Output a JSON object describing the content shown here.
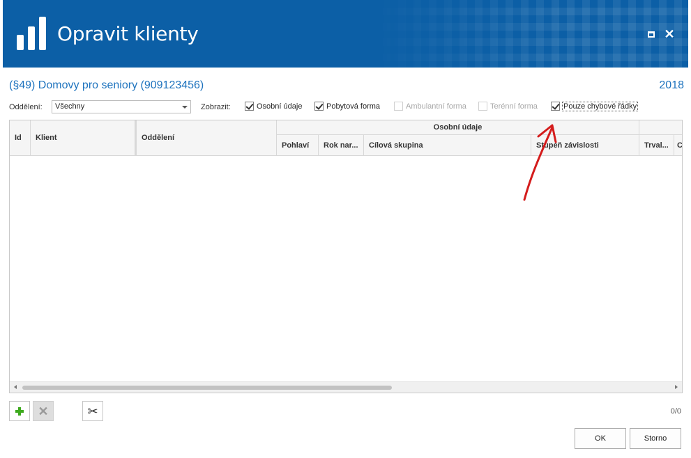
{
  "window": {
    "title": "Opravit klienty",
    "icon": "bar-chart-logo-icon",
    "controls": [
      "maximize-icon",
      "close-icon"
    ],
    "close_glyph": "✕"
  },
  "header": {
    "org_title": "(§49) Domovy pro seniory (909123456)",
    "year": "2018"
  },
  "filters": {
    "department_label": "Oddělení:",
    "department_value": "Všechny",
    "show_label": "Zobrazit:",
    "checkboxes": [
      {
        "label": "Osobní údaje",
        "checked": true,
        "enabled": true
      },
      {
        "label": "Pobytová forma",
        "checked": true,
        "enabled": true
      },
      {
        "label": "Ambulantní forma",
        "checked": false,
        "enabled": false
      },
      {
        "label": "Terénní forma",
        "checked": false,
        "enabled": false
      },
      {
        "label": "Pouze chybové řádky",
        "checked": true,
        "enabled": true
      }
    ]
  },
  "grid": {
    "group_header": "Osobní údaje",
    "columns": {
      "id": "Id",
      "client": "Klient",
      "department": "Oddělení",
      "gender": "Pohlaví",
      "birth_year": "Rok nar...",
      "target_group": "Cílová skupina",
      "dependency": "Stupeň závislosti",
      "permanent": "Trval...",
      "extra": "C"
    },
    "rows": []
  },
  "toolbar": {
    "add_icon": "plus-icon",
    "delete_icon": "delete-x-icon",
    "delete_glyph": "✕",
    "tools_icon": "wrench-screwdriver-icon",
    "tools_glyph": "✂"
  },
  "footer": {
    "counter": "0/0",
    "ok_label": "OK",
    "cancel_label": "Storno"
  },
  "annotation": {
    "color": "#d41c1c"
  },
  "colors": {
    "titlebar": "#0c5fa6",
    "accent_text": "#1e73be"
  }
}
